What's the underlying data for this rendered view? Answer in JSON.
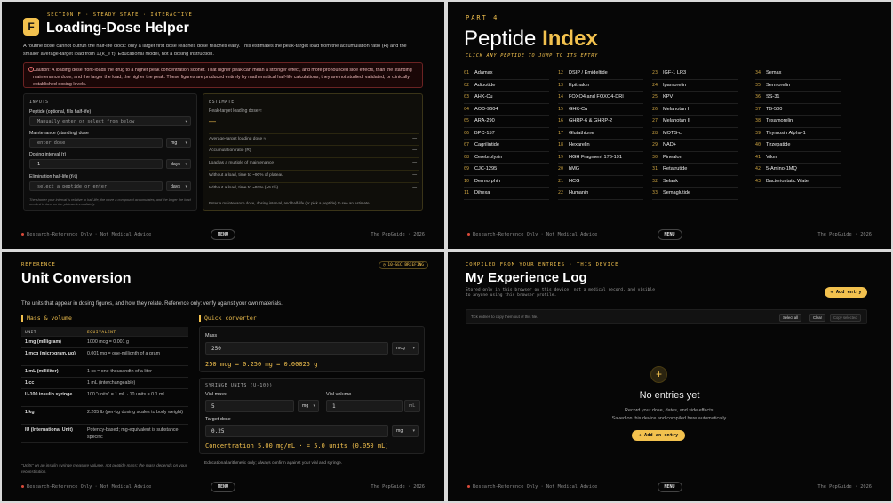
{
  "footer": {
    "left": "Research-Reference Only · Not Medical Advice",
    "menu": "MENU",
    "right": "The PepGuide · 2026"
  },
  "loading": {
    "badge": "F",
    "eyebrow": "SECTION F · STEADY STATE · INTERACTIVE",
    "title": "Loading-Dose Helper",
    "intro": "A routine dose cannot outrun the half-life clock: only a larger first dose reaches dose reaches early. This estimates the peak-target load from the accumulation ratio (R) and the smaller average-target load from 1/(k_e τ). Educational model, not a dosing instruction.",
    "caution": "Caution: A loading dose front-loads the drug to a higher peak concentration sooner. That higher peak can mean a stronger effect, and more pronounced side effects, than the standing maintenance dose, and the larger the load, the higher the peak.  These figures are produced entirely by mathematical half-life calculations; they are not studied, validated, or clinically established dosing levels.",
    "inputs_label": "INPUTS",
    "peptide_label": "Peptide (optional, fills half-life)",
    "peptide_placeholder": "Manually enter or select from below",
    "maint_label": "Maintenance (standing) dose",
    "maint_placeholder": "enter dose",
    "maint_unit": "mg",
    "interval_label": "Dosing interval (τ)",
    "interval_value": "1",
    "interval_unit": "days",
    "elim_label": "Elimination half-life (t½)",
    "elim_placeholder": "select a peptide or enter",
    "elim_unit": "days",
    "inputs_note": "The shorter your interval is relative to half-life, the more a compound accumulates, and the larger the load needed to land on the plateau immediately.",
    "estimate_label": "ESTIMATE",
    "peak_label": "Peak-target loading dose ≈",
    "peak_value": "—",
    "rows": [
      {
        "label": "Average-target loading dose ≈",
        "value": "—"
      },
      {
        "label": "Accumulation ratio (R)",
        "value": "—"
      },
      {
        "label": "Load as a multiple of maintenance",
        "value": "—"
      },
      {
        "label": "Without a load, time to ~90% of plateau",
        "value": "—"
      },
      {
        "label": "Without a load, time to ~97% (~5 t½)",
        "value": "—"
      }
    ],
    "estimate_note": "Enter a maintenance dose, dosing interval, and half-life (or pick a peptide) to see an estimate."
  },
  "index": {
    "part": "PART 4",
    "title_plain": "Peptide ",
    "title_accent": "Index",
    "sub": "CLICK ANY PEPTIDE TO JUMP TO ITS ENTRY",
    "columns": [
      [
        {
          "n": "01",
          "name": "Adamax"
        },
        {
          "n": "02",
          "name": "Adipotide"
        },
        {
          "n": "03",
          "name": "AHK-Cu"
        },
        {
          "n": "04",
          "name": "AOD-9604"
        },
        {
          "n": "05",
          "name": "ARA-290"
        },
        {
          "n": "06",
          "name": "BPC-157"
        },
        {
          "n": "07",
          "name": "Cagrilintide"
        },
        {
          "n": "08",
          "name": "Cerebrolysin"
        },
        {
          "n": "09",
          "name": "CJC-1295"
        },
        {
          "n": "10",
          "name": "Dermorphin"
        },
        {
          "n": "11",
          "name": "Dihexa"
        }
      ],
      [
        {
          "n": "12",
          "name": "DSIP / Emideltide"
        },
        {
          "n": "13",
          "name": "Epithalon"
        },
        {
          "n": "14",
          "name": "FOXO4 and FOXO4-DRI"
        },
        {
          "n": "15",
          "name": "GHK-Cu"
        },
        {
          "n": "16",
          "name": "GHRP-6 & GHRP-2"
        },
        {
          "n": "17",
          "name": "Glutathione"
        },
        {
          "n": "18",
          "name": "Hexarelin"
        },
        {
          "n": "19",
          "name": "HGH Fragment 176-191"
        },
        {
          "n": "20",
          "name": "hMG"
        },
        {
          "n": "21",
          "name": "HCG"
        },
        {
          "n": "22",
          "name": "Humanin"
        }
      ],
      [
        {
          "n": "23",
          "name": "IGF-1 LR3"
        },
        {
          "n": "24",
          "name": "Ipamorelin"
        },
        {
          "n": "25",
          "name": "KPV"
        },
        {
          "n": "26",
          "name": "Melanotan I"
        },
        {
          "n": "27",
          "name": "Melanotan II"
        },
        {
          "n": "28",
          "name": "MOTS-c"
        },
        {
          "n": "29",
          "name": "NAD+"
        },
        {
          "n": "30",
          "name": "Pinealon"
        },
        {
          "n": "31",
          "name": "Retatrutide"
        },
        {
          "n": "32",
          "name": "Selank"
        },
        {
          "n": "33",
          "name": "Semaglutide"
        }
      ],
      [
        {
          "n": "34",
          "name": "Semax"
        },
        {
          "n": "35",
          "name": "Sermorelin"
        },
        {
          "n": "36",
          "name": "SS-31"
        },
        {
          "n": "37",
          "name": "TB-500"
        },
        {
          "n": "38",
          "name": "Tesamorelin"
        },
        {
          "n": "39",
          "name": "Thymosin Alpha-1"
        },
        {
          "n": "40",
          "name": "Tirzepatide"
        },
        {
          "n": "41",
          "name": "Vilon"
        },
        {
          "n": "42",
          "name": "5-Amino-1MQ"
        },
        {
          "n": "43",
          "name": "Bacteriostatic Water"
        }
      ]
    ]
  },
  "units": {
    "eyebrow": "REFERENCE",
    "title": "Unit Conversion",
    "brief": "10-SEC BRIEFING",
    "intro": "The units that appear in dosing figures, and how they relate. Reference only: verify against your own materials.",
    "mv_title": "Mass & volume",
    "col_unit": "UNIT",
    "col_equiv": "EQUIVALENT",
    "rows": [
      {
        "unit": "1 mg (milligram)",
        "equiv": "1000 mcg = 0.001 g"
      },
      {
        "unit": "1 mcg (microgram, µg)",
        "equiv": "0.001 mg = one-millionth of a gram"
      },
      {
        "unit": "1 mL (milliliter)",
        "equiv": "1 cc = one-thousandth of a liter"
      },
      {
        "unit": "1 cc",
        "equiv": "1 mL (interchangeable)"
      },
      {
        "unit": "U-100 insulin syringe",
        "equiv": "100 \"units\" = 1 mL · 10 units = 0.1 mL"
      },
      {
        "unit": "1 kg",
        "equiv": "2.205 lb (per-kg dosing scales to body weight)"
      },
      {
        "unit": "IU (International Unit)",
        "equiv": "Potency-based; mg-equivalent is substance-specific"
      }
    ],
    "footnote": "\"Units\" on an insulin syringe measure volume, not peptide mass; the mass depends on your reconstitution.",
    "qc_title": "Quick converter",
    "mass_label": "Mass",
    "mass_value": "250",
    "mass_unit": "mcg",
    "mass_result": "250 mcg = 0.250 mg = 0.00025 g",
    "syringe_label": "SYRINGE UNITS (U-100)",
    "vial_mass_label": "Vial mass",
    "vial_mass_value": "5",
    "vial_mass_unit": "mg",
    "vial_vol_label": "Vial volume",
    "vial_vol_value": "1",
    "vial_vol_unit": "mL",
    "target_label": "Target dose",
    "target_value": "0.25",
    "target_unit": "mg",
    "conc_result": "Concentration 5.00 mg/mL · = 5.0 units (0.050 mL)",
    "qnote": "Educational arithmetic only; always confirm against your vial and syringe."
  },
  "log": {
    "eyebrow": "COMPILED FROM YOUR ENTRIES · THIS DEVICE",
    "title": "My Experience Log",
    "stored": "Stored only in this browser on this device, not a medical record, and visible to anyone using this browser profile.",
    "add_entry": "+ Add entry",
    "toolbar_hint": "Tick entries to copy them out of this file.",
    "select_all": "Select all",
    "clear": "Clear",
    "copy_selected": "Copy selected",
    "plus": "+",
    "none": "No entries yet",
    "rec1": "Record your dose, dates, and side effects.",
    "rec2": "Saved on this device and compiled here automatically.",
    "add_entry2": "+ Add an entry"
  }
}
